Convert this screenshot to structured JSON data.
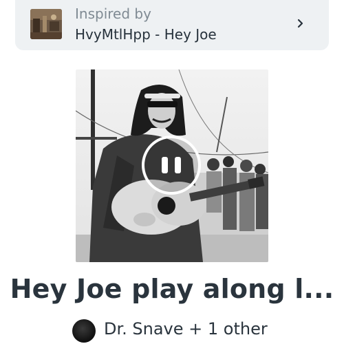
{
  "inspired_by": {
    "kicker": "Inspired by",
    "title": "HvyMtlHpp - Hey Joe",
    "thumbnail_icon": "photo-thumbnail",
    "chevron_icon": "chevron-right-icon"
  },
  "player": {
    "state_icon": "pause-icon"
  },
  "song": {
    "title": "Hey Joe play along l..."
  },
  "author": {
    "name": "Dr. Snave + 1 other",
    "avatar_icon": "avatar"
  },
  "colors": {
    "card_background": "#eef1f3",
    "kicker_text": "#7f8a93",
    "primary_text": "#2a343d"
  }
}
